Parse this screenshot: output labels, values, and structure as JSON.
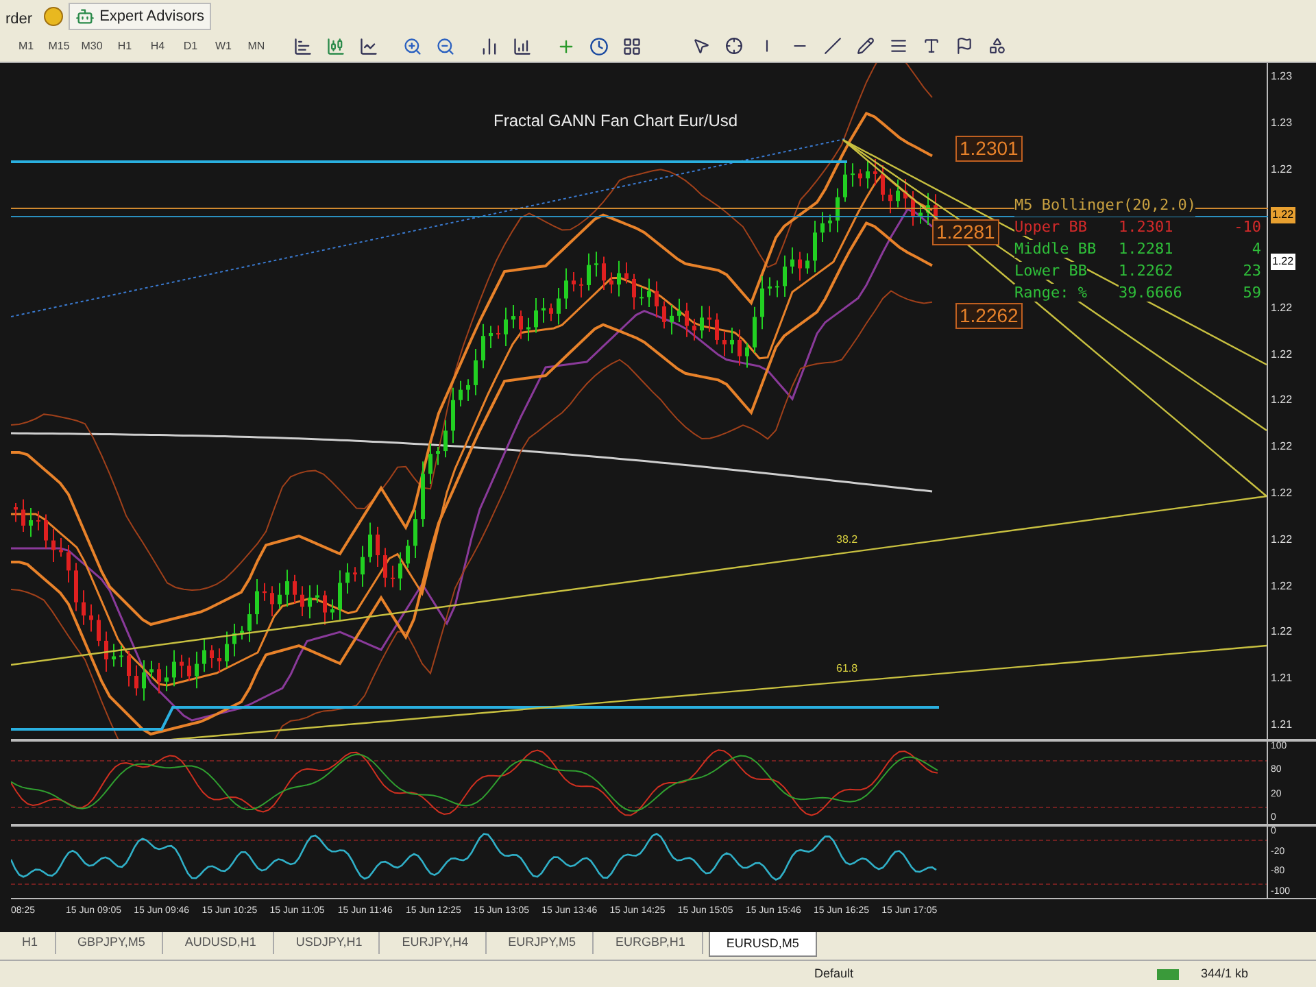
{
  "menu_tabs": [
    {
      "label": "rder",
      "kind": "plain"
    },
    {
      "label": "Expert Advisors",
      "kind": "advisors"
    }
  ],
  "timeframes": [
    "M1",
    "M15",
    "M30",
    "H1",
    "H4",
    "D1",
    "W1",
    "MN"
  ],
  "chart": {
    "title": "Fractal GANN Fan Chart  Eur/Usd",
    "price_labels": [
      "1.2301",
      "1.2281",
      "1.2262"
    ],
    "bollinger": {
      "title": "M5 Bollinger(20,2.0)",
      "rows": [
        {
          "name": "Upper BB",
          "value": "1.2301",
          "points": "-10",
          "color": "#d42a2a"
        },
        {
          "name": "Middle BB",
          "value": "1.2281",
          "points": "4",
          "color": "#2fbf3a"
        },
        {
          "name": "Lower BB",
          "value": "1.2262",
          "points": "23",
          "color": "#2fbf3a"
        },
        {
          "name": "Range: %",
          "value": "39.6666",
          "points": "59",
          "color": "#2fbf3a"
        }
      ]
    },
    "fib_labels": [
      "38.2",
      "61.8"
    ],
    "axis_labels": [
      {
        "text": "1.23",
        "kind": "tick"
      },
      {
        "text": "1.23",
        "kind": "tick"
      },
      {
        "text": "1.22",
        "kind": "tick"
      },
      {
        "text": "1.22",
        "kind": "bid"
      },
      {
        "text": "1.22",
        "kind": "ask"
      },
      {
        "text": "1.22",
        "kind": "tick"
      },
      {
        "text": "1.22",
        "kind": "tick"
      },
      {
        "text": "1.22",
        "kind": "tick"
      },
      {
        "text": "1.22",
        "kind": "tick"
      },
      {
        "text": "1.22",
        "kind": "tick"
      },
      {
        "text": "1.22",
        "kind": "tick"
      },
      {
        "text": "1.22",
        "kind": "tick"
      },
      {
        "text": "1.22",
        "kind": "tick"
      },
      {
        "text": "1.21",
        "kind": "tick"
      },
      {
        "text": "1.21",
        "kind": "tick"
      }
    ]
  },
  "oscillator_1": {
    "axis_labels": [
      "100",
      "80",
      "20",
      "0"
    ]
  },
  "oscillator_2": {
    "axis_labels": [
      "0",
      "-20",
      "-80",
      "-100"
    ]
  },
  "time_axis": [
    "08:25",
    "15 Jun 09:05",
    "15 Jun 09:46",
    "15 Jun 10:25",
    "15 Jun 11:05",
    "15 Jun 11:46",
    "15 Jun 12:25",
    "15 Jun 13:05",
    "15 Jun 13:46",
    "15 Jun 14:25",
    "15 Jun 15:05",
    "15 Jun 15:46",
    "15 Jun 16:25",
    "15 Jun 17:05"
  ],
  "symbol_tabs": [
    {
      "label": "H1",
      "selected": false
    },
    {
      "label": "GBPJPY,M5",
      "selected": false
    },
    {
      "label": "AUDUSD,H1",
      "selected": false
    },
    {
      "label": "USDJPY,H1",
      "selected": false
    },
    {
      "label": "EURJPY,H4",
      "selected": false
    },
    {
      "label": "EURJPY,M5",
      "selected": false
    },
    {
      "label": "EURGBP,H1",
      "selected": false
    },
    {
      "label": "EURUSD,M5",
      "selected": true
    }
  ],
  "status_bar": {
    "profile": "Default",
    "traffic": "344/1 kb"
  }
}
